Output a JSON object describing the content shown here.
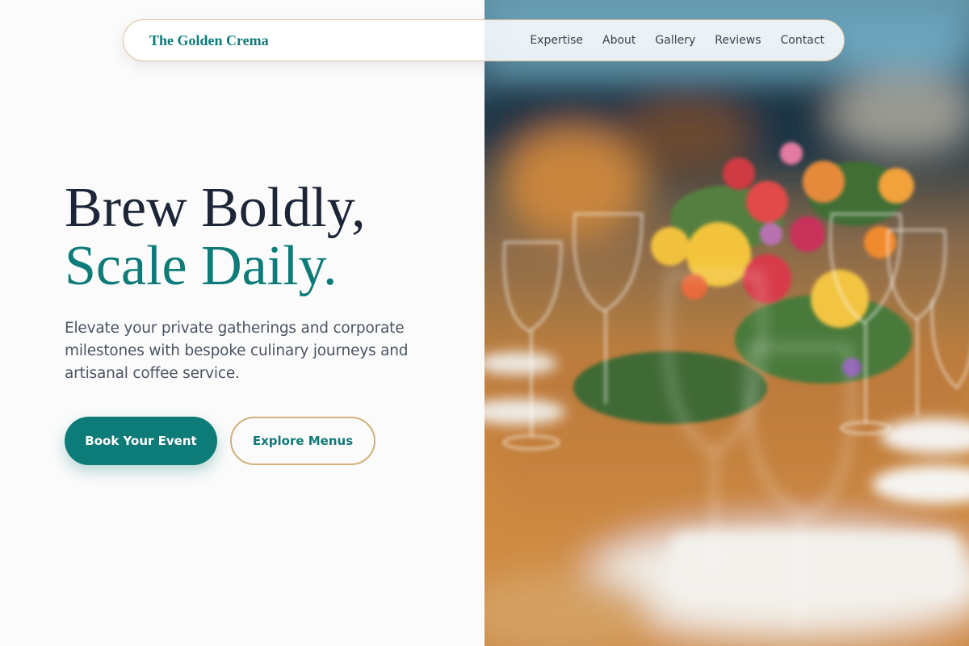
{
  "nav": {
    "brand": "The Golden Crema",
    "links": [
      "Expertise",
      "About",
      "Gallery",
      "Reviews",
      "Contact"
    ]
  },
  "hero": {
    "headline_line1": "Brew Boldly,",
    "headline_line2": "Scale Daily.",
    "subtext": "Elevate your private gatherings and corporate milestones with bespoke culinary journeys and artisanal coffee service.",
    "primary_button": "Book Your Event",
    "secondary_button": "Explore Menus"
  },
  "colors": {
    "accent_teal": "#0d7b78",
    "heading_navy": "#1d2638",
    "border_gold": "#d2b07c",
    "background": "#fbfbfb"
  }
}
